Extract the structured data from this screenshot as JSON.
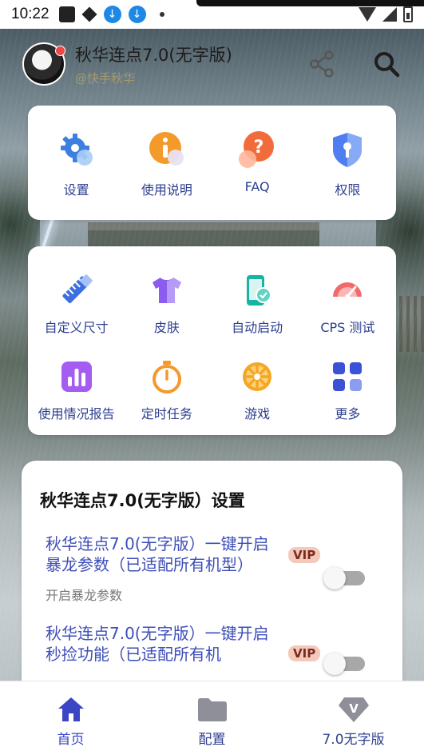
{
  "status_bar": {
    "time": "10:22",
    "download_glyph": "↓"
  },
  "header": {
    "title": "秋华连点7.0(无字版)",
    "subtitle": "@快手秋华"
  },
  "top_grid": [
    {
      "label": "设置",
      "icon": "settings-icon"
    },
    {
      "label": "使用说明",
      "icon": "info-icon"
    },
    {
      "label": "FAQ",
      "icon": "faq-icon"
    },
    {
      "label": "权限",
      "icon": "shield-icon"
    }
  ],
  "tools_grid": [
    {
      "label": "自定义尺寸",
      "icon": "ruler-icon"
    },
    {
      "label": "皮肤",
      "icon": "shirt-icon"
    },
    {
      "label": "自动启动",
      "icon": "phone-icon"
    },
    {
      "label": "CPS 测试",
      "icon": "gauge-icon"
    },
    {
      "label": "使用情况报告",
      "icon": "report-icon"
    },
    {
      "label": "定时任务",
      "icon": "timer-icon"
    },
    {
      "label": "游戏",
      "icon": "game-icon"
    },
    {
      "label": "更多",
      "icon": "more-icon"
    }
  ],
  "settings_card": {
    "title": "秋华连点7.0(无字版）设置",
    "options": [
      {
        "text": "秋华连点7.0(无字版）一键开启暴龙参数（已适配所有机型）",
        "badge": "VIP",
        "desc": "开启暴龙参数",
        "enabled": false
      },
      {
        "text": "秋华连点7.0(无字版）一键开启秒捡功能（已适配所有机",
        "badge": "VIP",
        "enabled": false
      }
    ]
  },
  "bottom_nav": [
    {
      "label": "首页",
      "icon": "home-icon",
      "active": true
    },
    {
      "label": "配置",
      "icon": "folder-icon",
      "active": false
    },
    {
      "label": "7.0无字版",
      "icon": "vip-diamond-icon",
      "active": false
    }
  ],
  "colors": {
    "accent": "#3b46c4",
    "label": "#2d3f8f",
    "vip_bg": "#f3c9bb"
  }
}
